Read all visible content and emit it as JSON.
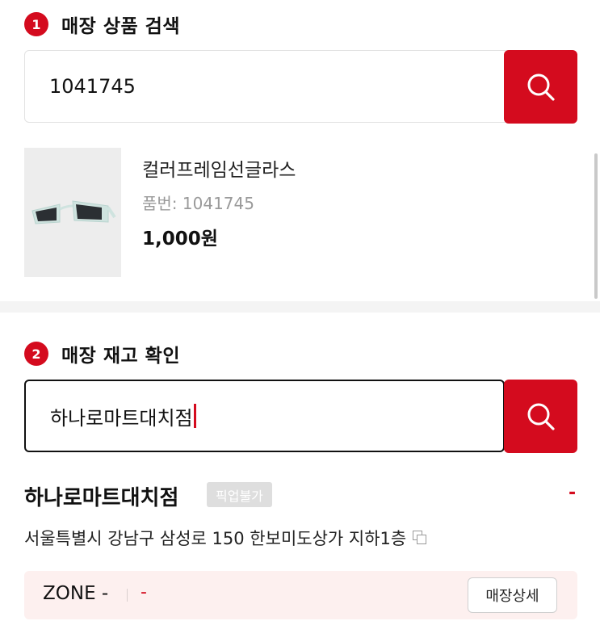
{
  "section1": {
    "number": "1",
    "title": "매장 상품 검색",
    "search_value": "1041745"
  },
  "product": {
    "name": "컬러프레임선글라스",
    "code_text": "품번: 1041745",
    "price": "1,000원"
  },
  "section2": {
    "number": "2",
    "title": "매장 재고 확인",
    "search_value": "하나로마트대치점"
  },
  "store": {
    "name": "하나로마트대치점",
    "pickup_badge": "픽업불가",
    "status": "-",
    "address": "서울특별시 강남구 삼성로 150 한보미도상가 지하1층",
    "zone_label": "ZONE -",
    "zone_value": "-",
    "detail_button": "매장상세"
  },
  "colors": {
    "accent": "#d40b1e",
    "zone_bg": "#fdf0ef",
    "badge_bg": "#dedede"
  },
  "icons": {
    "search": "search-icon",
    "copy": "copy-icon"
  }
}
